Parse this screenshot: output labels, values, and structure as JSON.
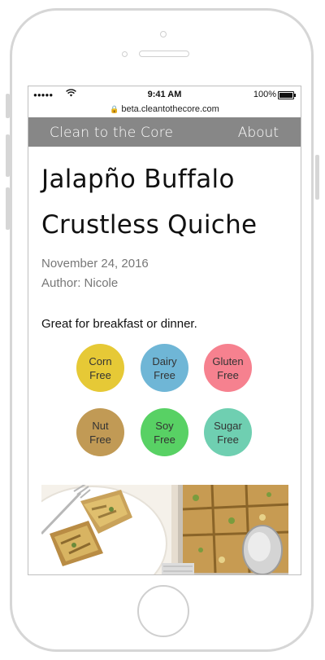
{
  "status_bar": {
    "signal": "●●●●●",
    "wifi_icon": "wifi-icon",
    "time": "9:41 AM",
    "battery_percent": "100%"
  },
  "url_bar": {
    "url": "beta.cleantothecore.com",
    "lock_icon": "lock-icon"
  },
  "navbar": {
    "brand": "Clean to the Core",
    "about": "About"
  },
  "recipe": {
    "title": "Jalapño Buffalo Crustless Quiche",
    "date": "November 24, 2016",
    "author": "Author: Nicole",
    "description": "Great for breakfast or dinner."
  },
  "badges": [
    {
      "line1": "Corn",
      "line2": "Free",
      "color": "#e6c936"
    },
    {
      "line1": "Dairy",
      "line2": "Free",
      "color": "#6fb6d6"
    },
    {
      "line1": "Gluten",
      "line2": "Free",
      "color": "#f6818f"
    },
    {
      "line1": "Nut",
      "line2": "Free",
      "color": "#c19a55"
    },
    {
      "line1": "Soy",
      "line2": "Free",
      "color": "#58d164"
    },
    {
      "line1": "Sugar",
      "line2": "Free",
      "color": "#6fcfb1"
    }
  ]
}
